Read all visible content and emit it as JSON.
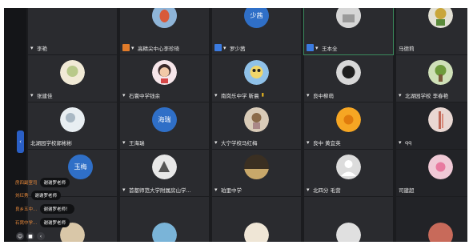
{
  "colors": {
    "window_bg": "#1b1c1f",
    "tile_bg": "#2a2b2f",
    "accent_blue": "#2f6fc7",
    "chat_name": "#e8893a"
  },
  "tiles": [
    {
      "id": "r0c0",
      "name": "李艳",
      "tag": null,
      "mic": true
    },
    {
      "id": "r0c1",
      "name": "高精尖中心李珍琦",
      "tag": "orange",
      "mic": true
    },
    {
      "id": "r0c2",
      "name": "罗少茜",
      "tag": "blue",
      "mic": true,
      "avatar_text": "少茜"
    },
    {
      "id": "r0c3",
      "name": "王本全",
      "tag": "blue",
      "mic": true
    },
    {
      "id": "r0c4",
      "name": "马德莉",
      "tag": null,
      "mic": false
    },
    {
      "id": "r1c0",
      "name": "张建佳",
      "tag": null,
      "mic": true
    },
    {
      "id": "r1c1",
      "name": "石寰中学钱余",
      "tag": null,
      "mic": true
    },
    {
      "id": "r1c2",
      "name": "南岗乐中学 靳晨",
      "tag": null,
      "mic": true
    },
    {
      "id": "r1c3",
      "name": "良中柳萌",
      "tag": null,
      "mic": true
    },
    {
      "id": "r1c4",
      "name": "北湖园学校 李春艳",
      "tag": null,
      "mic": true
    },
    {
      "id": "r2c0",
      "name": "北湖园学校郭彬彬",
      "tag": null,
      "mic": false
    },
    {
      "id": "r2c1",
      "name": "王海瑞",
      "tag": null,
      "mic": true,
      "avatar_text": "海瑞"
    },
    {
      "id": "r2c2",
      "name": "大宁学校马红梅",
      "tag": null,
      "mic": true
    },
    {
      "id": "r2c3",
      "name": "良中 黄宜英",
      "tag": null,
      "mic": true
    },
    {
      "id": "r2c4",
      "name": "qq",
      "tag": null,
      "mic": true
    },
    {
      "id": "r3c0",
      "name": "",
      "tag": null,
      "mic": false,
      "avatar_text": "玉梅"
    },
    {
      "id": "r3c1",
      "name": "首都师范大学附属房山学...",
      "tag": null,
      "mic": true
    },
    {
      "id": "r3c2",
      "name": "珀里中学",
      "tag": null,
      "mic": true
    },
    {
      "id": "r3c3",
      "name": "北四分 毛营",
      "tag": null,
      "mic": true
    },
    {
      "id": "r3c4",
      "name": "司建超",
      "tag": null,
      "mic": false
    },
    {
      "id": "r4c0",
      "name": "",
      "tag": null,
      "mic": false
    },
    {
      "id": "r4c1",
      "name": "",
      "tag": null,
      "mic": false
    },
    {
      "id": "r4c2",
      "name": "",
      "tag": null,
      "mic": false
    },
    {
      "id": "r4c3",
      "name": "",
      "tag": null,
      "mic": false
    },
    {
      "id": "r4c4",
      "name": "",
      "tag": null,
      "mic": false
    }
  ],
  "chat": [
    {
      "name": "房四副室司",
      "msg": "谢谢罗老师"
    },
    {
      "name": "刘红秀",
      "msg": "谢谢罗老师"
    },
    {
      "name": "良乡五中…",
      "msg": "谢谢罗老师！"
    },
    {
      "name": "石窝中学…",
      "msg": "谢谢罗老师"
    }
  ],
  "icons": {
    "mic": "microphone-icon",
    "toggle": "chevron-left-icon"
  }
}
